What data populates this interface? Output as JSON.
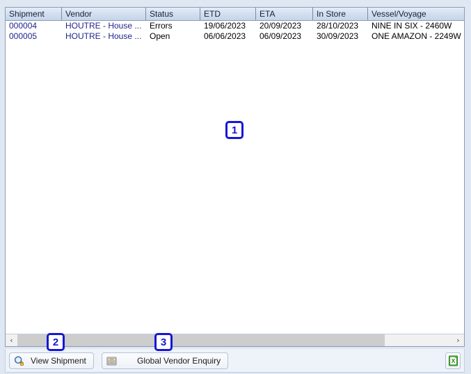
{
  "grid": {
    "columns": [
      {
        "key": "shipment",
        "label": "Shipment"
      },
      {
        "key": "vendor",
        "label": "Vendor"
      },
      {
        "key": "status",
        "label": "Status"
      },
      {
        "key": "etd",
        "label": "ETD"
      },
      {
        "key": "eta",
        "label": "ETA"
      },
      {
        "key": "in_store",
        "label": "In Store"
      },
      {
        "key": "vessel_voyage",
        "label": "Vessel/Voyage"
      }
    ],
    "rows": [
      {
        "shipment": "000004",
        "vendor": "HOUTRE - House ...",
        "status": "Errors",
        "etd": "19/06/2023",
        "eta": "20/09/2023",
        "in_store": "28/10/2023",
        "vessel_voyage": "NINE IN SIX - 2460W"
      },
      {
        "shipment": "000005",
        "vendor": "HOUTRE - House ...",
        "status": "Open",
        "etd": "06/06/2023",
        "eta": "06/09/2023",
        "in_store": "30/09/2023",
        "vessel_voyage": "ONE AMAZON - 2249W"
      }
    ],
    "link_color": "#20258c",
    "header_color": "#16213c"
  },
  "scrollbar": {
    "left_arrow": "‹",
    "right_arrow": "›",
    "thumb_width_percent": "84.5"
  },
  "toolbar": {
    "view_shipment_label": "View Shipment",
    "view_shipment_icon": "magnifier-lock-icon",
    "global_vendor_label": "Global Vendor Enquiry",
    "global_vendor_icon": "cabinet-drawer-icon",
    "export_icon": "excel-export-icon",
    "export_accent": "#4eae3a"
  },
  "annotations": {
    "badge_color": "#1616d8",
    "items": [
      {
        "number": "1",
        "target": "grid-body"
      },
      {
        "number": "2",
        "target": "view-shipment-button"
      },
      {
        "number": "3",
        "target": "global-vendor-enquiry-button"
      }
    ]
  }
}
